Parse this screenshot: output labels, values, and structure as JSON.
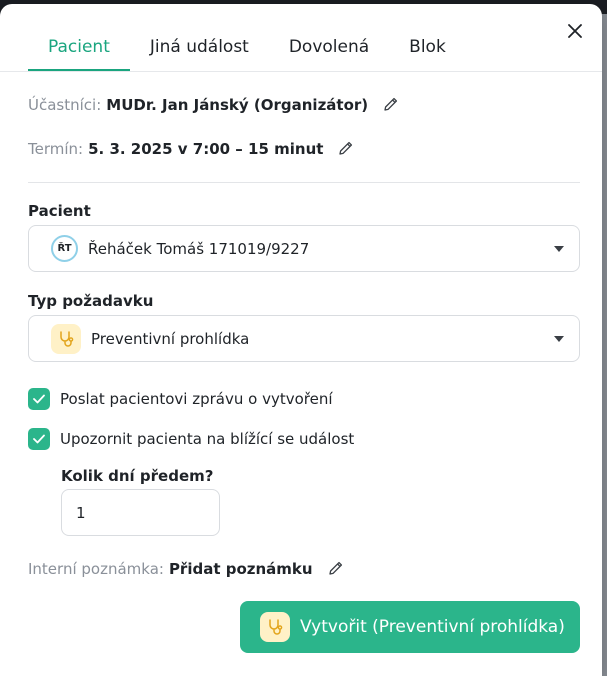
{
  "tabs": [
    {
      "label": "Pacient",
      "active": true
    },
    {
      "label": "Jiná událost",
      "active": false
    },
    {
      "label": "Dovolená",
      "active": false
    },
    {
      "label": "Blok",
      "active": false
    }
  ],
  "participants": {
    "label": "Účastníci:",
    "value": "MUDr. Jan Jánský (Organizátor)"
  },
  "term": {
    "label": "Termín:",
    "value": "5. 3. 2025 v 7:00 – 15 minut"
  },
  "patient": {
    "label": "Pacient",
    "avatar_initials": "ŘT",
    "value": "Řeháček Tomáš 171019/9227"
  },
  "request_type": {
    "label": "Typ požadavku",
    "icon": "stethoscope-icon",
    "value": "Preventivní prohlídka"
  },
  "options": {
    "send_message": {
      "label": "Poslat pacientovi zprávu o vytvoření",
      "checked": true
    },
    "notify": {
      "label": "Upozornit pacienta na blížící se událost",
      "checked": true
    }
  },
  "days_before": {
    "label": "Kolik dní předem?",
    "value": "1"
  },
  "note": {
    "label": "Interní poznámka:",
    "value": "Přidat poznámku"
  },
  "submit": {
    "label": "Vytvořit (Preventivní prohlídka)"
  },
  "colors": {
    "accent": "#2bb58b",
    "icon_bg": "#fff1c7",
    "icon_stroke": "#e2a41b",
    "avatar_ring": "#8fd0e8"
  }
}
